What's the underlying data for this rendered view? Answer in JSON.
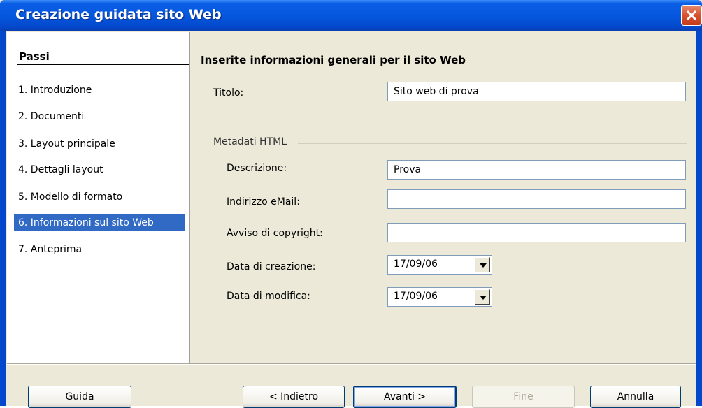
{
  "window": {
    "title": "Creazione guidata sito Web"
  },
  "sidebar": {
    "heading": "Passi",
    "steps": [
      {
        "label": "1. Introduzione"
      },
      {
        "label": "2. Documenti"
      },
      {
        "label": "3. Layout principale"
      },
      {
        "label": "4. Dettagli layout"
      },
      {
        "label": "5. Modello di formato"
      },
      {
        "label": "6. Informazioni sul sito Web",
        "active": true
      },
      {
        "label": "7. Anteprima"
      }
    ]
  },
  "main": {
    "heading": "Inserite informazioni generali per il sito Web",
    "title_label": "Titolo:",
    "title_value": "Sito web di prova",
    "group_label": "Metadati HTML",
    "description_label": "Descrizione:",
    "description_value": "Prova",
    "email_label": "Indirizzo eMail:",
    "email_value": "",
    "copyright_label": "Avviso di copyright:",
    "copyright_value": "",
    "created_label": "Data di creazione:",
    "created_value": "17/09/06",
    "modified_label": "Data di modifica:",
    "modified_value": "17/09/06"
  },
  "buttons": {
    "help": "Guida",
    "back": "< Indietro",
    "next": "Avanti >",
    "finish": "Fine",
    "cancel": "Annulla"
  },
  "colors": {
    "titlebar": "#0556dc",
    "selection": "#316ac5",
    "face": "#ece9d8"
  }
}
